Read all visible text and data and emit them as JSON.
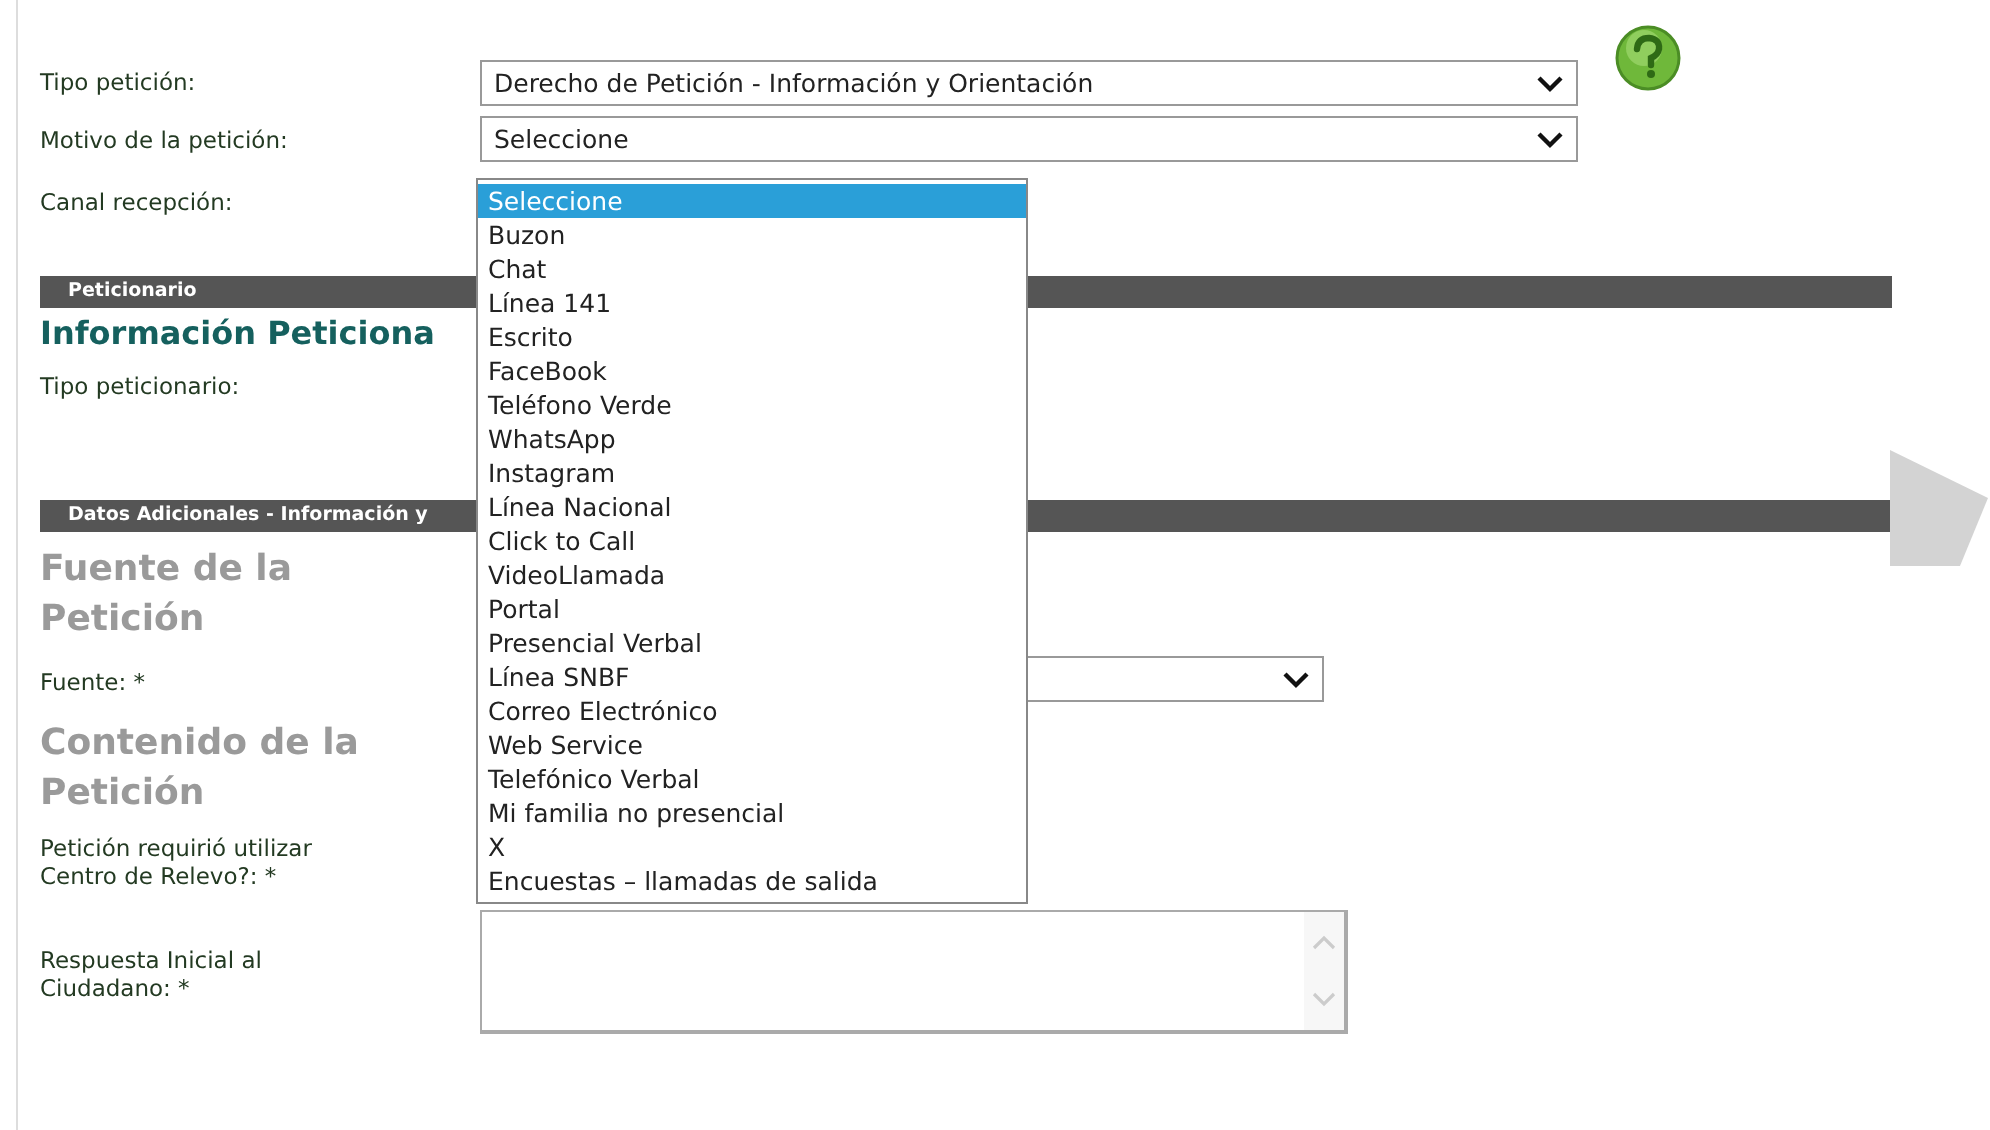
{
  "tipo_peticion": {
    "label": "Tipo petición:",
    "value": "Derecho de Petición - Información y Orientación"
  },
  "motivo": {
    "label": "Motivo de la petición:",
    "value": "Seleccione"
  },
  "canal": {
    "label": "Canal recepción:",
    "expanded": true,
    "options": [
      {
        "label": "Seleccione",
        "selected": true
      },
      {
        "label": "Buzon",
        "selected": false
      },
      {
        "label": "Chat",
        "selected": false
      },
      {
        "label": "Línea 141",
        "selected": false
      },
      {
        "label": "Escrito",
        "selected": false
      },
      {
        "label": "FaceBook",
        "selected": false
      },
      {
        "label": "Teléfono Verde",
        "selected": false
      },
      {
        "label": "WhatsApp",
        "selected": false
      },
      {
        "label": "Instagram",
        "selected": false
      },
      {
        "label": "Línea Nacional",
        "selected": false
      },
      {
        "label": "Click to Call",
        "selected": false
      },
      {
        "label": "VideoLlamada",
        "selected": false
      },
      {
        "label": "Portal",
        "selected": false
      },
      {
        "label": "Presencial Verbal",
        "selected": false
      },
      {
        "label": "Línea SNBF",
        "selected": false
      },
      {
        "label": "Correo Electrónico",
        "selected": false
      },
      {
        "label": "Web Service",
        "selected": false
      },
      {
        "label": "Telefónico Verbal",
        "selected": false
      },
      {
        "label": "Mi familia no presencial",
        "selected": false
      },
      {
        "label": "X",
        "selected": false
      },
      {
        "label": "Encuestas – llamadas de salida",
        "selected": false
      }
    ]
  },
  "peticionario_section": {
    "bar_title": "Peticionario",
    "heading": "Información Peticiona",
    "fields": [
      {
        "kind": "hidden",
        "label": "Tipo peticionario:"
      }
    ]
  },
  "datos_section": {
    "bar_title": "Datos Adicionales - Información y",
    "fields": [
      {
        "kind": "heading",
        "label": "Fuente de la Petición"
      },
      {
        "kind": "select",
        "label": "Fuente: *"
      },
      {
        "kind": "heading",
        "label": "Contenido de la Petición"
      },
      {
        "kind": "hidden",
        "label": "Petición requirió utilizar Centro de Relevo?: *"
      },
      {
        "kind": "textarea",
        "label": "Respuesta Inicial al Ciudadano: *"
      }
    ]
  }
}
